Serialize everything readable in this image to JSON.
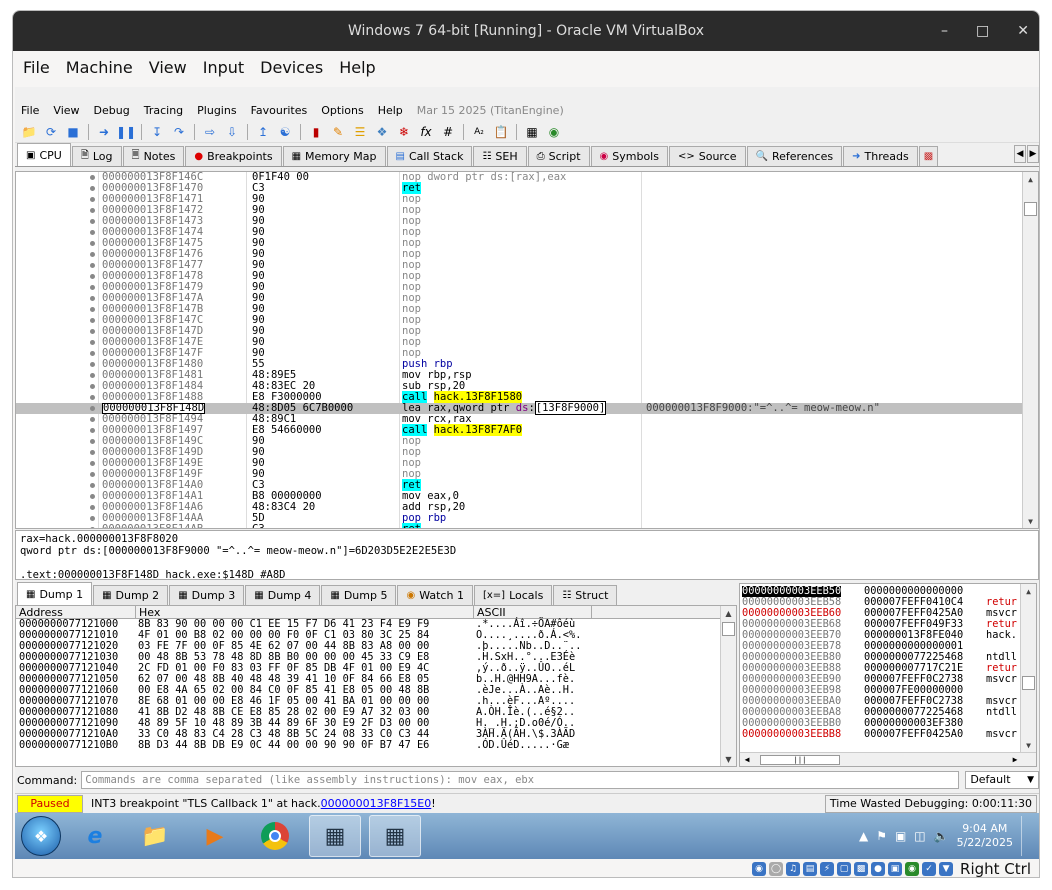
{
  "host": {
    "title": "Windows 7 64-bit [Running] - Oracle VM VirtualBox",
    "menu": [
      "File",
      "Machine",
      "View",
      "Input",
      "Devices",
      "Help"
    ],
    "right_ctrl": "Right Ctrl"
  },
  "dbg": {
    "menu": [
      "File",
      "View",
      "Debug",
      "Tracing",
      "Plugins",
      "Favourites",
      "Options",
      "Help"
    ],
    "date": "Mar 15 2025 (TitanEngine)",
    "tabs": [
      "CPU",
      "Log",
      "Notes",
      "Breakpoints",
      "Memory Map",
      "Call Stack",
      "SEH",
      "Script",
      "Symbols",
      "Source",
      "References",
      "Threads"
    ]
  },
  "disasm": [
    {
      "addr": "000000013F8F146C",
      "bytes": "0F1F40 00",
      "ins": [
        {
          "t": "nop dword ptr ds:[rax],eax",
          "c": "nop"
        }
      ]
    },
    {
      "addr": "000000013F8F1470",
      "bytes": "C3",
      "ins": [
        {
          "t": "ret",
          "c": "ret"
        }
      ]
    },
    {
      "addr": "000000013F8F1471",
      "bytes": "90",
      "ins": [
        {
          "t": "nop",
          "c": "nop"
        }
      ]
    },
    {
      "addr": "000000013F8F1472",
      "bytes": "90",
      "ins": [
        {
          "t": "nop",
          "c": "nop"
        }
      ]
    },
    {
      "addr": "000000013F8F1473",
      "bytes": "90",
      "ins": [
        {
          "t": "nop",
          "c": "nop"
        }
      ]
    },
    {
      "addr": "000000013F8F1474",
      "bytes": "90",
      "ins": [
        {
          "t": "nop",
          "c": "nop"
        }
      ]
    },
    {
      "addr": "000000013F8F1475",
      "bytes": "90",
      "ins": [
        {
          "t": "nop",
          "c": "nop"
        }
      ]
    },
    {
      "addr": "000000013F8F1476",
      "bytes": "90",
      "ins": [
        {
          "t": "nop",
          "c": "nop"
        }
      ]
    },
    {
      "addr": "000000013F8F1477",
      "bytes": "90",
      "ins": [
        {
          "t": "nop",
          "c": "nop"
        }
      ]
    },
    {
      "addr": "000000013F8F1478",
      "bytes": "90",
      "ins": [
        {
          "t": "nop",
          "c": "nop"
        }
      ]
    },
    {
      "addr": "000000013F8F1479",
      "bytes": "90",
      "ins": [
        {
          "t": "nop",
          "c": "nop"
        }
      ]
    },
    {
      "addr": "000000013F8F147A",
      "bytes": "90",
      "ins": [
        {
          "t": "nop",
          "c": "nop"
        }
      ]
    },
    {
      "addr": "000000013F8F147B",
      "bytes": "90",
      "ins": [
        {
          "t": "nop",
          "c": "nop"
        }
      ]
    },
    {
      "addr": "000000013F8F147C",
      "bytes": "90",
      "ins": [
        {
          "t": "nop",
          "c": "nop"
        }
      ]
    },
    {
      "addr": "000000013F8F147D",
      "bytes": "90",
      "ins": [
        {
          "t": "nop",
          "c": "nop"
        }
      ]
    },
    {
      "addr": "000000013F8F147E",
      "bytes": "90",
      "ins": [
        {
          "t": "nop",
          "c": "nop"
        }
      ]
    },
    {
      "addr": "000000013F8F147F",
      "bytes": "90",
      "ins": [
        {
          "t": "nop",
          "c": "nop"
        }
      ]
    },
    {
      "addr": "000000013F8F1480",
      "bytes": "55",
      "ins": [
        {
          "t": "push rbp",
          "c": "push"
        }
      ]
    },
    {
      "addr": "000000013F8F1481",
      "bytes": "48:89E5",
      "ins": [
        {
          "t": "mov rbp,rsp",
          "c": ""
        }
      ]
    },
    {
      "addr": "000000013F8F1484",
      "bytes": "48:83EC 20",
      "ins": [
        {
          "t": "sub rsp,20",
          "c": ""
        }
      ]
    },
    {
      "addr": "000000013F8F1488",
      "bytes": "E8 F3000000",
      "ins": [
        {
          "t": "call",
          "c": "call"
        },
        {
          "t": " ",
          "c": ""
        },
        {
          "t": "hack.13F8F1580",
          "c": "tgt"
        }
      ]
    },
    {
      "addr": "000000013F8F148D",
      "bytes": "48:8D05 6C7B0000",
      "sel": true,
      "ins": [
        {
          "t": "lea rax,qword ptr ",
          "c": ""
        },
        {
          "t": "ds",
          "c": "seg"
        },
        {
          "t": ":",
          "c": ""
        },
        {
          "t": "[13F8F9000]",
          "c": "mem"
        }
      ],
      "cmt": "000000013F8F9000:\"=^..^= meow-meow.n\""
    },
    {
      "addr": "000000013F8F1494",
      "bytes": "48:89C1",
      "ins": [
        {
          "t": "mov rcx,rax",
          "c": ""
        }
      ]
    },
    {
      "addr": "000000013F8F1497",
      "bytes": "E8 54660000",
      "ins": [
        {
          "t": "call",
          "c": "call"
        },
        {
          "t": " ",
          "c": ""
        },
        {
          "t": "hack.13F8F7AF0",
          "c": "tgt"
        }
      ]
    },
    {
      "addr": "000000013F8F149C",
      "bytes": "90",
      "ins": [
        {
          "t": "nop",
          "c": "nop"
        }
      ]
    },
    {
      "addr": "000000013F8F149D",
      "bytes": "90",
      "ins": [
        {
          "t": "nop",
          "c": "nop"
        }
      ]
    },
    {
      "addr": "000000013F8F149E",
      "bytes": "90",
      "ins": [
        {
          "t": "nop",
          "c": "nop"
        }
      ]
    },
    {
      "addr": "000000013F8F149F",
      "bytes": "90",
      "ins": [
        {
          "t": "nop",
          "c": "nop"
        }
      ]
    },
    {
      "addr": "000000013F8F14A0",
      "bytes": "C3",
      "ins": [
        {
          "t": "ret",
          "c": "ret"
        }
      ]
    },
    {
      "addr": "000000013F8F14A1",
      "bytes": "B8 00000000",
      "ins": [
        {
          "t": "mov eax,0",
          "c": ""
        }
      ]
    },
    {
      "addr": "000000013F8F14A6",
      "bytes": "48:83C4 20",
      "ins": [
        {
          "t": "add rsp,20",
          "c": ""
        }
      ]
    },
    {
      "addr": "000000013F8F14AA",
      "bytes": "5D",
      "ins": [
        {
          "t": "pop rbp",
          "c": "pop"
        }
      ]
    },
    {
      "addr": "000000013F8F14AB",
      "bytes": "C3",
      "ins": [
        {
          "t": "ret",
          "c": "ret"
        }
      ]
    }
  ],
  "info": {
    "line1": "rax=hack.000000013F8F8020",
    "line2": "qword ptr ds:[000000013F8F9000 \"=^..^= meow-meow.n\"]=6D203D5E2E2E5E3D",
    "line3": ".text:000000013F8F148D hack.exe:$148D #A8D"
  },
  "dump": {
    "tabs": [
      "Dump 1",
      "Dump 2",
      "Dump 3",
      "Dump 4",
      "Dump 5",
      "Watch 1",
      "Locals",
      "Struct"
    ],
    "headers": [
      "Address",
      "Hex",
      "ASCII"
    ],
    "rows": [
      [
        "0000000077121000",
        "8B 83 90 00 00 00 C1 EE 15 F7 D6 41 23 F4 E9 F9",
        ".*....Áî.÷ÖA#ôéù"
      ],
      [
        "0000000077121010",
        "4F 01 00 B8 02 00 00 00 F0 0F C1 03 80 3C 25 84",
        "O....¸....ð.Á.<%."
      ],
      [
        "0000000077121020",
        "03 FE 7F 00 0F 85 4E 62 07 00 44 8B 83 A8 00 00",
        ".þ.....Nb..D..¨.."
      ],
      [
        "0000000077121030",
        "00 48 8B 53 78 48 8D 8B B0 00 00 00 45 33 C9 E8",
        ".H.SxH..°...E3Éè"
      ],
      [
        "0000000077121040",
        "2C FD 01 00 F0 83 03 FF 0F 85 DB 4F 01 00 E9 4C",
        ",ý..ð..ÿ..ÛO..éL"
      ],
      [
        "0000000077121050",
        "62 07 00 48 8B 40 48 48 39 41 10 0F 84 66 E8 05",
        "b..H.@HH9A...fè."
      ],
      [
        "0000000077121060",
        "00 E8 4A 65 02 00 84 C0 0F 85 41 E8 05 00 48 8B",
        ".èJe...À..Aè..H."
      ],
      [
        "0000000077121070",
        "8E 68 01 00 00 E8 46 1F 05 00 41 BA 01 00 00 00",
        ".h...èF...Aº...."
      ],
      [
        "0000000077121080",
        "41 8B D2 48 8B CE E8 85 28 02 00 E9 A7 32 03 00",
        "A.ÒH.Îè.(..é§2.."
      ],
      [
        "0000000077121090",
        "48 89 5F 10 48 89 3B 44 89 6F 30 E9 2F D3 00 00",
        "H._.H.;D.o0é/Ó.."
      ],
      [
        "00000000771210A0",
        "33 C0 48 83 C4 28 C3 48 8B 5C 24 08 33 C0 C3 44",
        "3ÀH.Ä(ÃH.\\$.3ÀÃD"
      ],
      [
        "00000000771210B0",
        "8B D3 44 8B DB E9 0C 44 00 00 90 90 0F B7 47 E6",
        ".ÓD.ÛéD.....·Gæ"
      ]
    ]
  },
  "stack": [
    {
      "a": "00000000003EEB50",
      "v": "0000000000000000",
      "c": "",
      "style": "hl"
    },
    {
      "a": "00000000003EEB58",
      "v": "000007FEFF0410C4",
      "c": "retur",
      "style": "",
      "cr": true
    },
    {
      "a": "00000000003EEB60",
      "v": "000007FEFF0425A0",
      "c": "msvcr",
      "style": "red"
    },
    {
      "a": "00000000003EEB68",
      "v": "000007FEFF049F33",
      "c": "retur",
      "style": "",
      "cr": true
    },
    {
      "a": "00000000003EEB70",
      "v": "000000013F8FE040",
      "c": "hack.",
      "style": ""
    },
    {
      "a": "00000000003EEB78",
      "v": "0000000000000001",
      "c": "",
      "style": ""
    },
    {
      "a": "00000000003EEB80",
      "v": "0000000077225468",
      "c": "ntdll",
      "style": ""
    },
    {
      "a": "00000000003EEB88",
      "v": "000000007717C21E",
      "c": "retur",
      "style": "",
      "cr": true
    },
    {
      "a": "00000000003EEB90",
      "v": "000007FEFF0C2738",
      "c": "msvcr",
      "style": ""
    },
    {
      "a": "00000000003EEB98",
      "v": "000007FE00000000",
      "c": "",
      "style": ""
    },
    {
      "a": "00000000003EEBA0",
      "v": "000007FEFF0C2738",
      "c": "msvcr",
      "style": ""
    },
    {
      "a": "00000000003EEBA8",
      "v": "0000000077225468",
      "c": "ntdll",
      "style": ""
    },
    {
      "a": "00000000003EEBB0",
      "v": "00000000003EF380",
      "c": "",
      "style": ""
    },
    {
      "a": "00000000003EEBB8",
      "v": "000007FEFF0425A0",
      "c": "msvcr",
      "style": "red"
    }
  ],
  "cmd": {
    "label": "Command:",
    "placeholder": "Commands are comma separated (like assembly instructions): mov eax, ebx",
    "mode": "Default"
  },
  "status": {
    "state": "Paused",
    "msg_prefix": "INT3 breakpoint \"TLS Callback 1\" at hack.",
    "msg_link": "000000013F8F15E0",
    "msg_suffix": "!",
    "time": "Time Wasted Debugging: 0:00:11:30"
  },
  "clock": {
    "time": "9:04 AM",
    "date": "5/22/2025"
  }
}
